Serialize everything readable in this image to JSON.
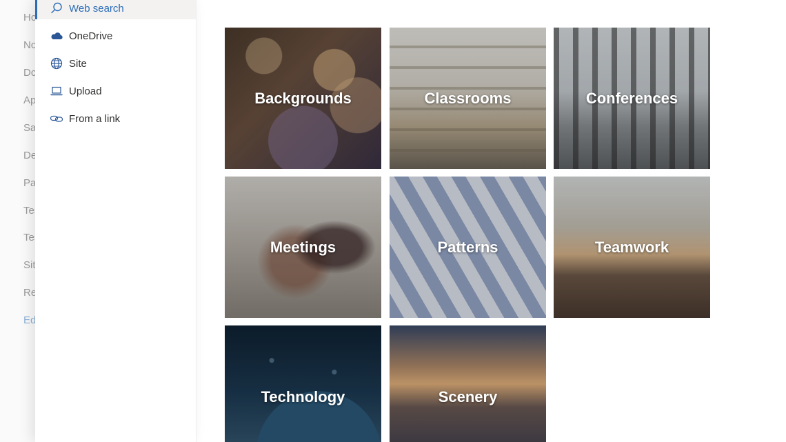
{
  "background_nav": {
    "items": [
      "Hc",
      "Nc",
      "Dc",
      "Ap",
      "Sa",
      "De",
      "Pa",
      "Tes",
      "Tes",
      "Sit",
      "Re",
      "Ed"
    ],
    "active_index": 11
  },
  "panel": {
    "items": [
      {
        "label": "Web search",
        "icon": "search-icon",
        "selected": true
      },
      {
        "label": "OneDrive",
        "icon": "cloud-icon",
        "selected": false
      },
      {
        "label": "Site",
        "icon": "globe-icon",
        "selected": false
      },
      {
        "label": "Upload",
        "icon": "laptop-icon",
        "selected": false
      },
      {
        "label": "From a link",
        "icon": "link-icon",
        "selected": false
      }
    ]
  },
  "tiles": [
    {
      "label": "Backgrounds"
    },
    {
      "label": "Classrooms"
    },
    {
      "label": "Conferences"
    },
    {
      "label": "Meetings"
    },
    {
      "label": "Patterns"
    },
    {
      "label": "Teamwork"
    },
    {
      "label": "Technology"
    },
    {
      "label": "Scenery"
    }
  ],
  "colors": {
    "accent": "#2b6cb8",
    "selected_background": "#f3f2f1",
    "text": "#323130"
  }
}
